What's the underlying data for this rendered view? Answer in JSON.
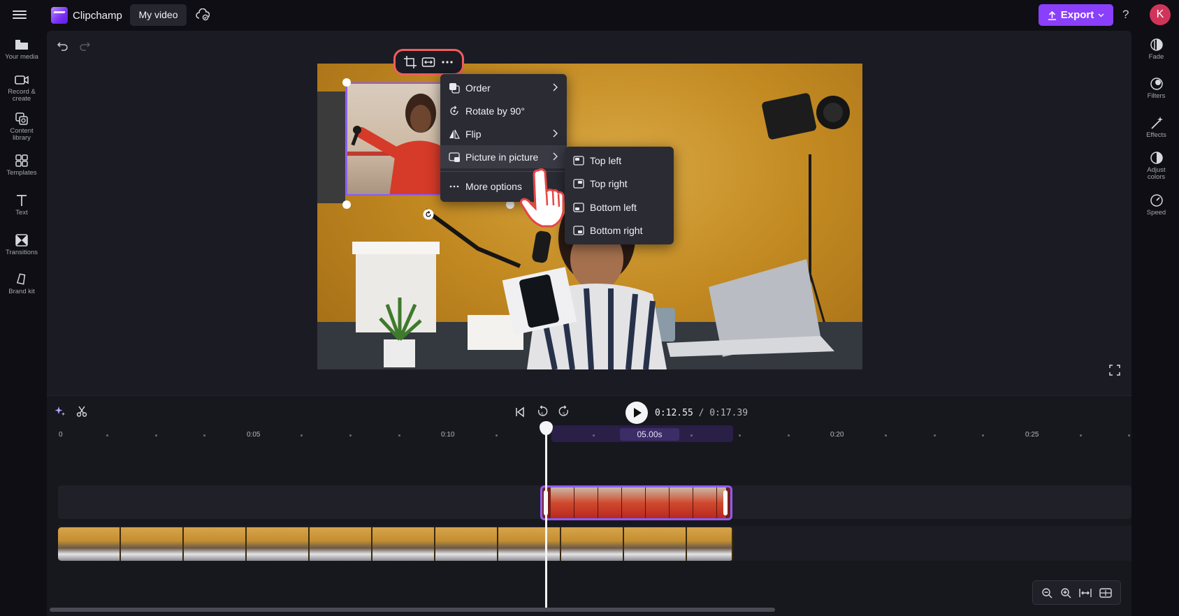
{
  "header": {
    "app_name": "Clipchamp",
    "project_name": "My video",
    "export_label": "Export",
    "help_label": "?",
    "avatar_initial": "K"
  },
  "left_sidebar": {
    "items": [
      {
        "label": "Your media",
        "icon": "folder-icon"
      },
      {
        "label": "Record &",
        "label2": "create",
        "icon": "camera-icon"
      },
      {
        "label": "Content",
        "label2": "library",
        "icon": "library-icon"
      },
      {
        "label": "Templates",
        "icon": "templates-icon"
      },
      {
        "label": "Text",
        "icon": "text-icon"
      },
      {
        "label": "Transitions",
        "icon": "transitions-icon"
      },
      {
        "label": "Brand kit",
        "icon": "brand-kit-icon"
      }
    ]
  },
  "right_sidebar": {
    "items": [
      {
        "label": "Fade",
        "icon": "fade-icon"
      },
      {
        "label": "Filters",
        "icon": "filters-icon"
      },
      {
        "label": "Effects",
        "icon": "effects-icon"
      },
      {
        "label": "Adjust",
        "label2": "colors",
        "icon": "adjust-colors-icon"
      },
      {
        "label": "Speed",
        "icon": "speed-icon"
      }
    ]
  },
  "context_menu": {
    "items": [
      {
        "label": "Order",
        "icon": "order-icon",
        "has_submenu": true
      },
      {
        "label": "Rotate by 90°",
        "icon": "rotate-icon",
        "has_submenu": false
      },
      {
        "label": "Flip",
        "icon": "flip-icon",
        "has_submenu": true
      },
      {
        "label": "Picture in picture",
        "icon": "pip-icon",
        "has_submenu": true
      },
      {
        "label": "More options",
        "icon": "more-icon",
        "has_submenu": false
      }
    ]
  },
  "pip_submenu": {
    "items": [
      {
        "label": "Top left"
      },
      {
        "label": "Top right"
      },
      {
        "label": "Bottom left"
      },
      {
        "label": "Bottom right"
      }
    ]
  },
  "timeline": {
    "current_time": "0:12.55",
    "separator": " / ",
    "total_time": "0:17.39",
    "selection_duration": "05.00s",
    "ruler_labels": [
      "0",
      "0:05",
      "0:10",
      "0:20",
      "0:25"
    ]
  },
  "colors": {
    "accent": "#8a3ffc",
    "highlight_ring": "#f15d5d",
    "avatar": "#d1345b"
  }
}
